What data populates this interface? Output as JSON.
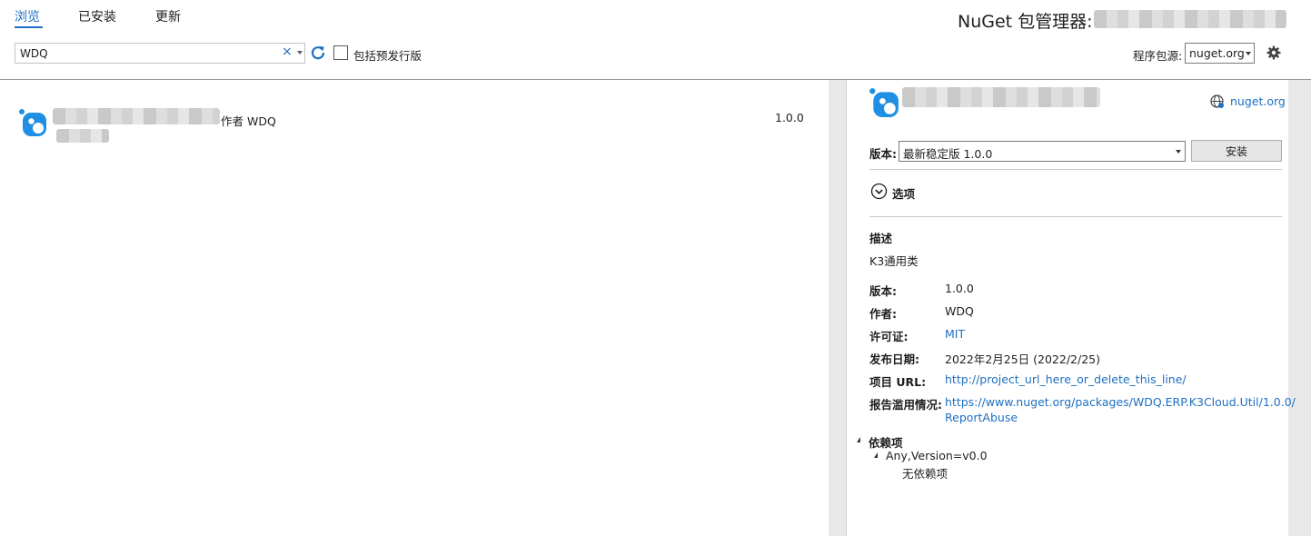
{
  "tabs": [
    {
      "label": "浏览",
      "active": true
    },
    {
      "label": "已安装",
      "active": false
    },
    {
      "label": "更新",
      "active": false
    }
  ],
  "title": "NuGet 包管理器:",
  "search": {
    "value": "WDQ",
    "clear_glyph": "×"
  },
  "prerelease": {
    "label": "包括预发行版",
    "checked": false
  },
  "source": {
    "label": "程序包源:",
    "value": "nuget.org"
  },
  "package_list": [
    {
      "author": "作者 WDQ",
      "version": "1.0.0"
    }
  ],
  "details": {
    "source_link": "nuget.org",
    "version_label": "版本:",
    "version_selected": "最新稳定版 1.0.0",
    "install_label": "安装",
    "options_label": "选项",
    "description_heading": "描述",
    "description_text": "K3通用类",
    "meta": [
      {
        "key": "版本:",
        "value": "1.0.0",
        "is_link": false
      },
      {
        "key": "作者:",
        "value": "WDQ",
        "is_link": false
      },
      {
        "key": "许可证:",
        "value": "MIT",
        "is_link": true
      },
      {
        "key": "发布日期:",
        "value": "2022年2月25日 (2022/2/25)",
        "is_link": false
      },
      {
        "key": "项目 URL:",
        "value": "http://project_url_here_or_delete_this_line/",
        "is_link": true
      },
      {
        "key": "报告滥用情况:",
        "value": "https://www.nuget.org/packages/WDQ.ERP.K3Cloud.Util/1.0.0/",
        "value_line2": "ReportAbuse",
        "is_link": true
      }
    ],
    "dependencies_heading": "依赖项",
    "dependency_framework": "Any,Version=v0.0",
    "no_dependencies": "无依赖项"
  },
  "colors": {
    "accent": "#1e6fc2",
    "text": "#1e1e1e",
    "scrollbar": "#e8e8e8"
  },
  "icons": [
    "refresh-icon",
    "gear-icon",
    "nuget-package-icon",
    "globe-icon",
    "chevron-down-circle-icon",
    "expand-triangle-icon"
  ]
}
